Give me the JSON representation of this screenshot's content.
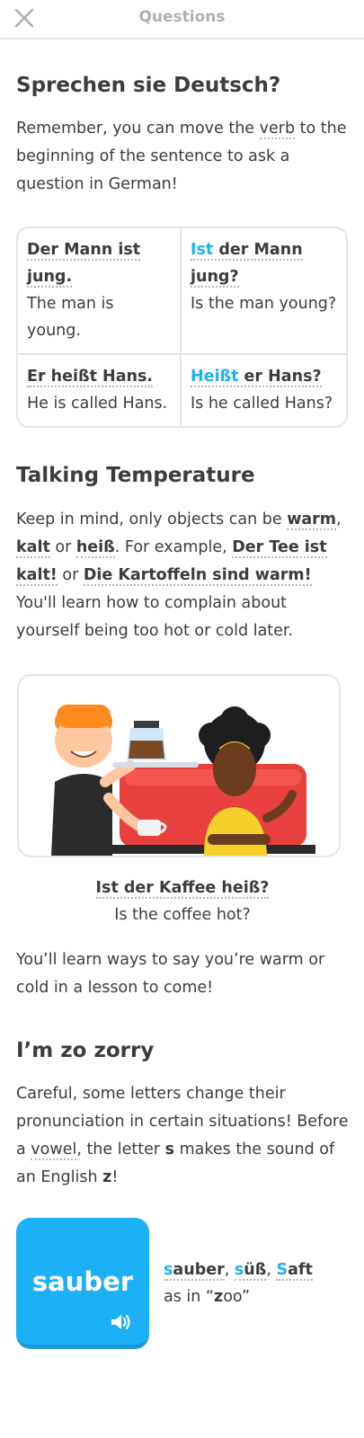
{
  "header": {
    "title": "Questions"
  },
  "section1": {
    "heading": "Sprechen sie Deutsch?",
    "intro_before": "Remember, you can move the ",
    "intro_term": "verb",
    "intro_after": " to the beginning of the sentence to ask a question in German!",
    "table": [
      {
        "de": "Der Mann ist jung.",
        "en": "The man is young."
      },
      {
        "de_highlight": "Ist",
        "de_rest": " der Mann jung?",
        "en": "Is the man young?"
      },
      {
        "de": "Er heißt Hans.",
        "en": "He is called Hans."
      },
      {
        "de_highlight": "Heißt",
        "de_rest": " er Hans?",
        "en": "Is he called Hans?"
      }
    ]
  },
  "section2": {
    "heading": "Talking Temperature",
    "t1": "Keep in mind, only objects can be ",
    "w1": "warm",
    "t2": ", ",
    "w2": "kalt",
    "t3": " or ",
    "w3": "heiß",
    "t4": ". For example, ",
    "ex1": "Der Tee ist kalt!",
    "t5": " or ",
    "ex2": "Die Kartoffeln sind warm!",
    "t6": " You'll learn how to complain about yourself being too hot or cold later.",
    "caption_de": "Ist der Kaffee heiß?",
    "caption_en": "Is the coffee hot?",
    "outro": "You’ll learn ways to say you’re warm or cold in a lesson to come!"
  },
  "section3": {
    "heading": "I’m zo zorry",
    "t1": "Careful, some letters change their pronunciation in certain situations! Before a ",
    "term": "vowel",
    "t2": ", the letter ",
    "letter_s": "s",
    "t3": " makes the sound of an English ",
    "letter_z": "z",
    "t4": "!",
    "card_word": "sauber",
    "examples": [
      {
        "hl": "s",
        "rest": "auber"
      },
      {
        "hl": "s",
        "rest": "üß"
      },
      {
        "hl": "S",
        "rest": "aft"
      }
    ],
    "sep": ", ",
    "as_in_before": "as in “",
    "as_in_z": "z",
    "as_in_after": "oo”"
  },
  "colors": {
    "accent_blue": "#1cb0f6",
    "muted": "#afafaf",
    "text": "#3c3c3c",
    "border": "#e5e5e5"
  },
  "icons": {
    "close": "close-icon",
    "speaker": "speaker-icon"
  }
}
